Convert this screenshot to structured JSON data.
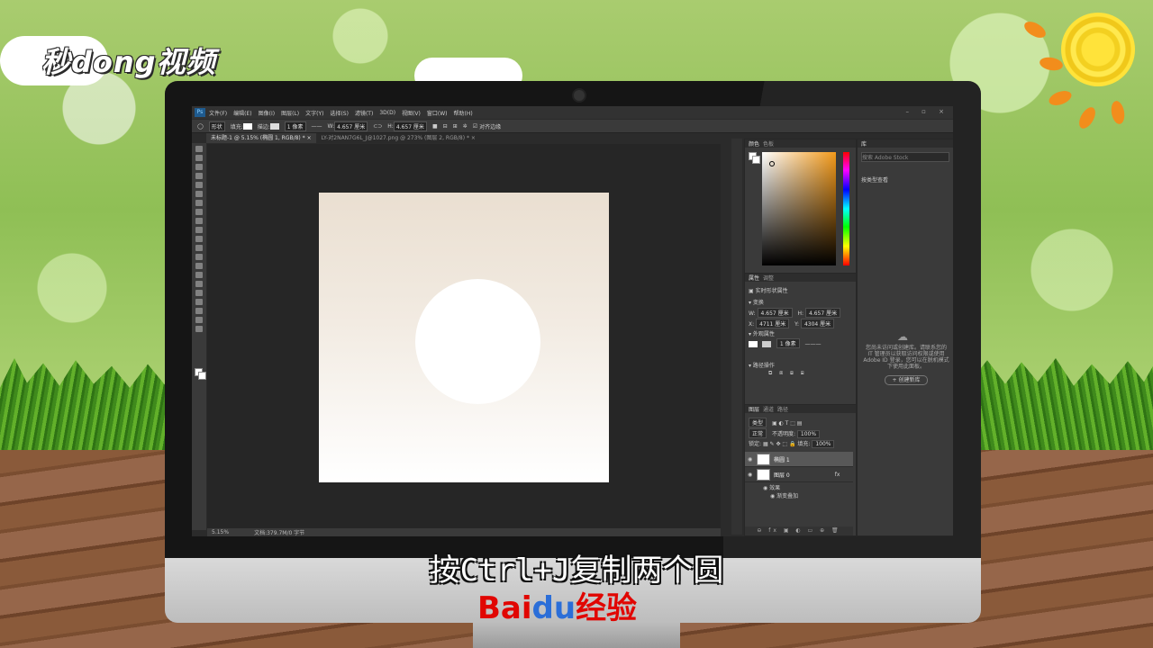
{
  "watermark": {
    "logo": "秒dong视频"
  },
  "subtitle": "按Ctrl+J复制两个圆",
  "brand": {
    "bai": "Bai",
    "du": "du",
    "suffix": "经验"
  },
  "menubar": {
    "items": [
      "文件(F)",
      "编辑(E)",
      "图像(I)",
      "图层(L)",
      "文字(Y)",
      "选择(S)",
      "滤镜(T)",
      "3D(D)",
      "视图(V)",
      "窗口(W)",
      "帮助(H)"
    ]
  },
  "options": {
    "shape_mode": "形状",
    "fill_label": "填充:",
    "stroke_label": "描边:",
    "stroke_width": "1 像素",
    "w_label": "W:",
    "w_value": "4.657 厘米",
    "h_label": "H:",
    "h_value": "4.657 厘米",
    "align_edges": "对齐边缘"
  },
  "tabs": [
    {
      "label": "未标题-1 @ 5.15% (椭圆 1, RGB/8) * ×"
    },
    {
      "label": "LY-对2NAN7G6L_J@1027.png @ 273% (图层 2, RGB/8) * ×"
    }
  ],
  "status": {
    "zoom": "5.15%",
    "doc": "文档:379.7M/0 字节"
  },
  "color_panel": {
    "tabs": [
      "颜色",
      "色板"
    ]
  },
  "properties_panel": {
    "tabs": [
      "属性",
      "调整"
    ],
    "title": "实时形状属性",
    "transform_label": "变换",
    "w_label": "W:",
    "w_value": "4.657 厘米",
    "h_label": "H:",
    "h_value": "4.657 厘米",
    "x_label": "X:",
    "x_value": "4711 厘米",
    "y_label": "Y:",
    "y_value": "4304 厘米",
    "appearance_label": "外观属性",
    "stroke_value": "1 像素",
    "ops_label": "路径操作"
  },
  "layers_panel": {
    "tabs": [
      "图层",
      "通道",
      "路径"
    ],
    "kind": "类型",
    "blend_mode": "正常",
    "opacity_label": "不透明度:",
    "opacity_value": "100%",
    "lock_label": "锁定:",
    "fill_label": "填充:",
    "fill_value": "100%",
    "layers": [
      {
        "name": "椭圆 1",
        "selected": true
      },
      {
        "name": "图层 0",
        "selected": false,
        "fx": "fx"
      }
    ],
    "effects_label": "效果",
    "effect_name": "渐变叠加"
  },
  "libraries_panel": {
    "tab": "库",
    "search_placeholder": "搜索 Adobe Stock",
    "filter": "按类型查看",
    "message": "您尚未访问或创建库。请联系您的 IT 管理员以获取访问权限或使用 Adobe ID 登录，您可以在脱机模式下使用此面板。",
    "create_button": "+ 创建新库"
  }
}
